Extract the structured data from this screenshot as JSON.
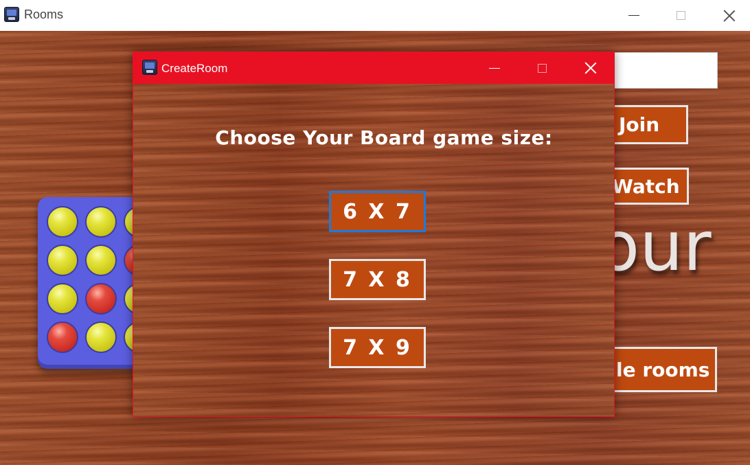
{
  "outer_window": {
    "title": "Rooms",
    "icon": "game-app-icon",
    "controls": {
      "minimize": "minimize-icon",
      "maximize": "maximize-icon",
      "close": "close-icon"
    },
    "background": {
      "join_label": "Join",
      "watch_label": "Watch",
      "partial_word": "our",
      "rooms_label": "le rooms",
      "search_value": ""
    },
    "board_discs": [
      [
        "yellow",
        "yellow",
        "yellow"
      ],
      [
        "yellow",
        "yellow",
        "red"
      ],
      [
        "yellow",
        "red",
        "yellow"
      ],
      [
        "red",
        "yellow",
        "yellow"
      ]
    ]
  },
  "dialog": {
    "title": "CreateRoom",
    "icon": "game-app-icon",
    "accent_color": "#e81123",
    "heading": "Choose Your Board game size:",
    "options": [
      {
        "label": "6 X 7",
        "focused": true
      },
      {
        "label": "7 X 8",
        "focused": false
      },
      {
        "label": "7 X 9",
        "focused": false
      }
    ],
    "button_color": "#bf4a10"
  }
}
